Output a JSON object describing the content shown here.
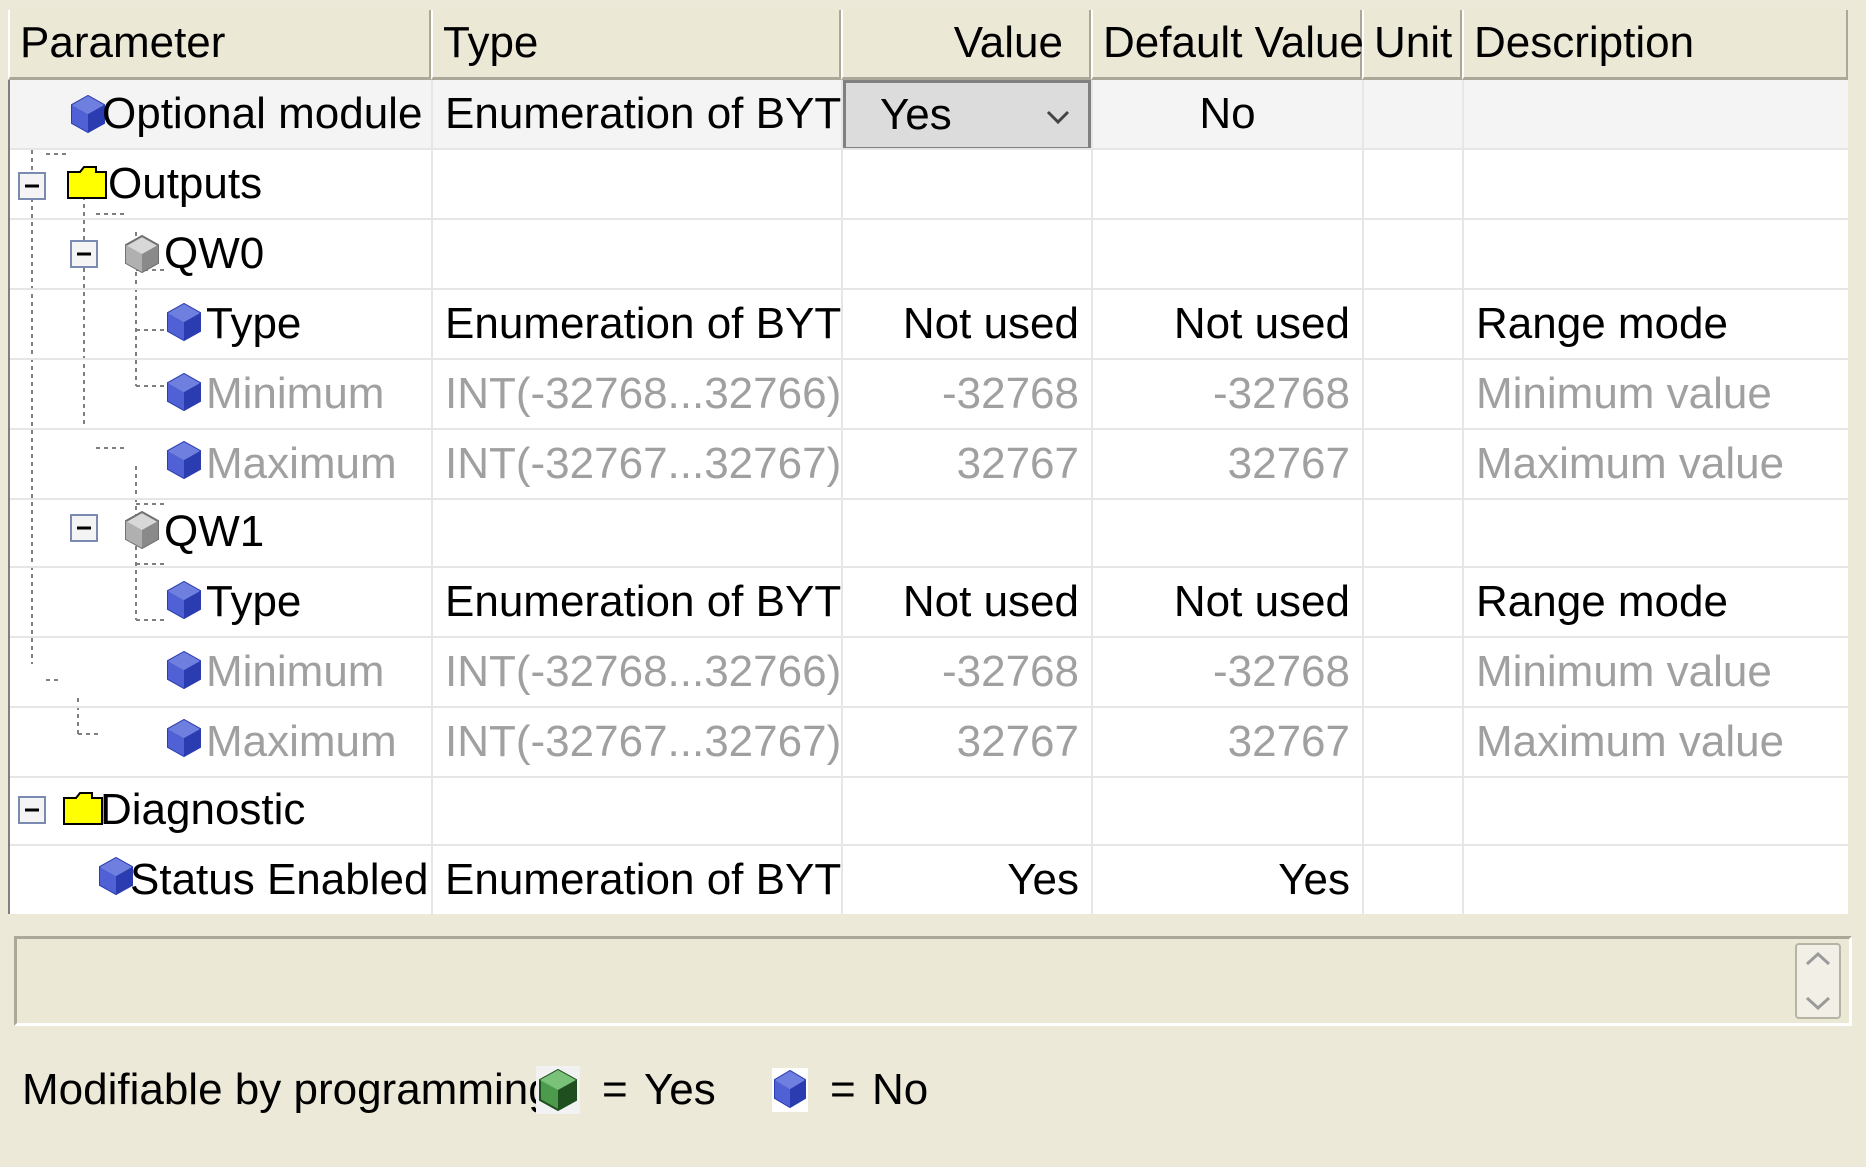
{
  "columns": {
    "parameter": "Parameter",
    "type": "Type",
    "value": "Value",
    "default_value": "Default Value",
    "unit": "Unit",
    "description": "Description"
  },
  "rows": [
    {
      "label": "Optional module",
      "type": "Enumeration of BYTE",
      "value": "Yes",
      "default": "No",
      "unit": "",
      "description": "",
      "icon": "blue-cube-icon"
    },
    {
      "label": "Outputs",
      "type": "",
      "value": "",
      "default": "",
      "unit": "",
      "description": "",
      "icon": "folder-icon"
    },
    {
      "label": "QW0",
      "type": "",
      "value": "",
      "default": "",
      "unit": "",
      "description": "",
      "icon": "gray-cube-icon"
    },
    {
      "label": "Type",
      "type": "Enumeration of BYTE",
      "value": "Not used",
      "default": "Not used",
      "unit": "",
      "description": "Range mode",
      "icon": "blue-cube-icon"
    },
    {
      "label": "Minimum",
      "type": "INT(-32768...32766)",
      "value": "-32768",
      "default": "-32768",
      "unit": "",
      "description": "Minimum value",
      "icon": "blue-cube-icon"
    },
    {
      "label": "Maximum",
      "type": "INT(-32767...32767)",
      "value": "32767",
      "default": "32767",
      "unit": "",
      "description": "Maximum value",
      "icon": "blue-cube-icon"
    },
    {
      "label": "QW1",
      "type": "",
      "value": "",
      "default": "",
      "unit": "",
      "description": "",
      "icon": "gray-cube-icon"
    },
    {
      "label": "Type",
      "type": "Enumeration of BYTE",
      "value": "Not used",
      "default": "Not used",
      "unit": "",
      "description": "Range mode",
      "icon": "blue-cube-icon"
    },
    {
      "label": "Minimum",
      "type": "INT(-32768...32766)",
      "value": "-32768",
      "default": "-32768",
      "unit": "",
      "description": "Minimum value",
      "icon": "blue-cube-icon"
    },
    {
      "label": "Maximum",
      "type": "INT(-32767...32767)",
      "value": "32767",
      "default": "32767",
      "unit": "",
      "description": "Maximum value",
      "icon": "blue-cube-icon"
    },
    {
      "label": "Diagnostic",
      "type": "",
      "value": "",
      "default": "",
      "unit": "",
      "description": "",
      "icon": "folder-icon"
    },
    {
      "label": "Status Enabled",
      "type": "Enumeration of BYTE",
      "value": "Yes",
      "default": "Yes",
      "unit": "",
      "description": "",
      "icon": "blue-cube-icon"
    }
  ],
  "legend": {
    "label": "Modifiable by programming",
    "equals": "=",
    "yes": "Yes",
    "no": "No",
    "yes_icon": "green-cube-icon",
    "no_icon": "blue-cube-icon"
  },
  "colors": {
    "window_bg": "#ece9d8",
    "grid_bg": "#ffffff",
    "dim_text": "#a0a0a0",
    "folder": "#ffff00",
    "cube_blue": "#3a4fd0",
    "cube_green": "#2e6b2e"
  }
}
